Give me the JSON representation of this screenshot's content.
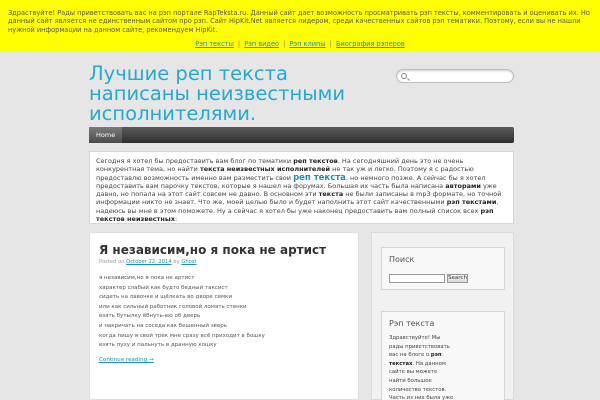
{
  "topbar": {
    "text": "Здраствуйте! Рады приветствовать вас на рэп портале RapTeksta.ru. Данный сайт дает возможность просматривать рэп тексты, комментировать и оценивать их. Но данный сайт является не единственным сайтом про рэп. Сайт HipKit.Net является лидером, среди качественных сайтов рэп тематики. Поэтому, если вы не нашли нужной информации на данном сайте, рекомендуем HipKit.",
    "links": [
      "Рэп тексты",
      "Рэп видео",
      "Рэп клипы",
      "Биография рэперов"
    ],
    "separator": "|"
  },
  "header": {
    "site_title": "Лучшие реп текста написаны неизвестными исполнителями."
  },
  "nav": {
    "home": "Home"
  },
  "intro": {
    "t1": "Сегодня я хотел бы предоставить вам блог по тематики ",
    "b1": "реп текстов",
    "t2": ". На сегодняшний день это не очень конкурентная тема, но найти ",
    "b2": "текста неизвестных исполнителей",
    "t3": " не так уж и легко. Поэтому я с радостью предоставлю возможность именно вам разместить свои ",
    "big": "реп текста",
    "t4": ", но немного позже. А сейчас бы я хотел предоставить вам парочку текстов, которые я нашел на форумах. Большая их часть была написана ",
    "b3": "авторами",
    "t5": " уже давно, но попала на этот сайт совсем не давно. В основном эти ",
    "b4": "текста",
    "t6": " не были записаны в mp3 формате, но точной информации никто не знает. Что же, моей целью было и будет наполнить этот сайт качественными ",
    "b5": "рэп текстами",
    "t7": ", надеюсь вы мне в этом поможете. Ну а сейчас я хотел бы уже наконец предоставить вам полный список всех ",
    "b6": "рэп текстов неизвестных",
    "t8": ":"
  },
  "post": {
    "title": "Я независим,но я пока не артист",
    "meta_prefix": "Posted on",
    "date": "October 22, 2014",
    "meta_by": "by",
    "author": "Ghost",
    "lines": [
      "я независим,но я пока не артист",
      "характер слабый как будто бедный таксист",
      "сидеть на лавочке и щёлкать во дворе семки",
      "или как сильный работник головой ломать стенки",
      "взять бутылку ёбнуть-ею об дверь",
      "и накричать на соседа как бешенный зверь",
      "когда пишу я свой трек мне сразу всё приходит в бошку",
      "взять пуху и пальнуть в дранную кошку"
    ],
    "continue": "Continue reading →"
  },
  "sidebar": {
    "search_title": "Поиск",
    "search_button": "Search",
    "rap_title": "Рэп текста",
    "rap_t1": "Здравствуйте! Мы рады приветствовать вас на блоге о ",
    "rap_b1": "рэп текстах",
    "rap_t2": ". На данном сайте вы можете найти большое количество текстов. Часть из них была уже"
  }
}
